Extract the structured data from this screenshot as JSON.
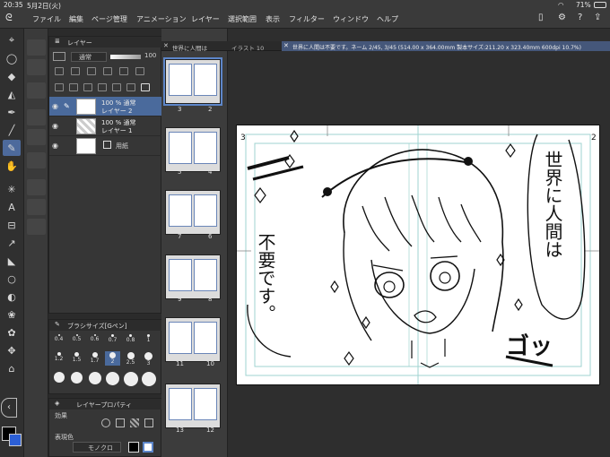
{
  "status": {
    "time": "20:35",
    "date": "5月2日(火)",
    "battery": "71%"
  },
  "menu": [
    "ファイル",
    "編集",
    "ページ管理",
    "アニメーション",
    "レイヤー",
    "選択範囲",
    "表示",
    "フィルター",
    "ウィンドウ",
    "ヘルプ"
  ],
  "layer_panel": {
    "title": "レイヤー",
    "blend": "通常",
    "opacity": "100",
    "layers": [
      {
        "line1": "100 % 通常",
        "line2": "レイヤー 2",
        "active": true
      },
      {
        "line1": "100 % 通常",
        "line2": "レイヤー 1",
        "active": false
      },
      {
        "line1": "",
        "line2": "用紙",
        "active": false
      }
    ]
  },
  "brush_panel": {
    "title": "ブラシサイズ[Gペン]",
    "sizes": [
      "0.4",
      "0.5",
      "0.6",
      "0.7",
      "0.8",
      "1",
      "1.2",
      "1.5",
      "1.7",
      "2",
      "2.5",
      "3"
    ],
    "selected": "2"
  },
  "property_panel": {
    "title": "レイヤープロパティ",
    "effect_label": "効果",
    "color_label": "表現色",
    "color_value": "モノクロ"
  },
  "tabs": {
    "tab1": "世界に人間は",
    "tab2": "イラスト 10",
    "active_tab": "世界に人間は不要です。ネーム 2/45, 3/45 (514.00 x 364.00mm 製本サイズ:211.20 x 323.40mm 600dpi 10.7%)"
  },
  "pages": [
    {
      "left": "3",
      "right": "2"
    },
    {
      "left": "5",
      "right": "4"
    },
    {
      "left": "7",
      "right": "6"
    },
    {
      "left": "9",
      "right": "8"
    },
    {
      "left": "11",
      "right": "10"
    },
    {
      "left": "13",
      "right": "12"
    }
  ],
  "canvas": {
    "page_left": "3",
    "page_right": "2",
    "text_right": "世界に人間は",
    "text_left": "不要です。",
    "text_sfx": "ゴッ"
  },
  "colors": {
    "accent": "#4a6a9c",
    "selected_page": "#5d86c9",
    "panel": "#363636"
  }
}
